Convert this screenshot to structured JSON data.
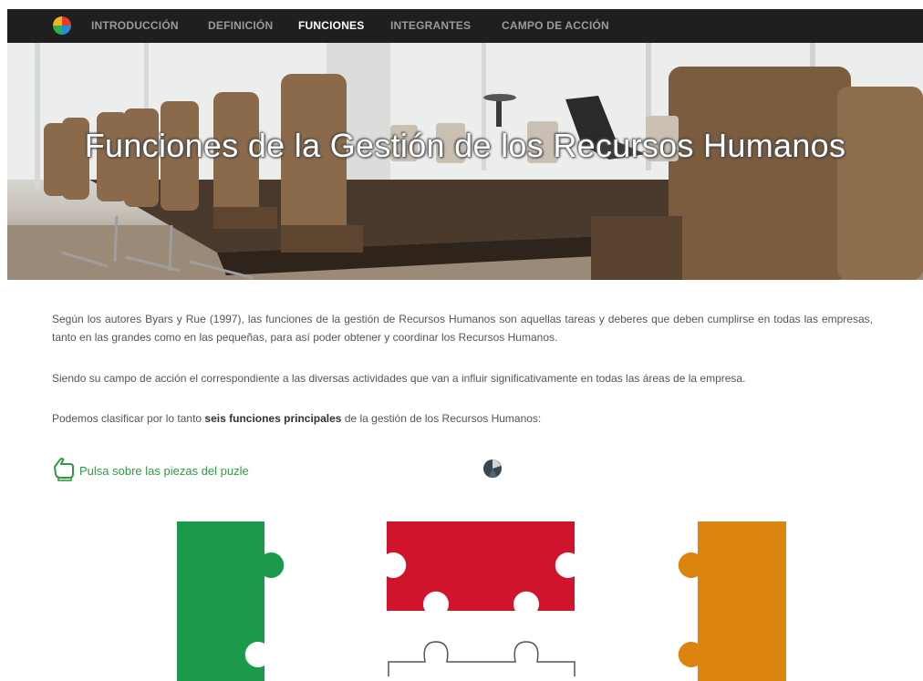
{
  "nav": {
    "items": [
      {
        "label": "INTRODUCCIÓN"
      },
      {
        "label": "DEFINICIÓN"
      },
      {
        "label": "FUNCIONES"
      },
      {
        "label": "INTEGRANTES"
      },
      {
        "label": "CAMPO DE ACCIÓN"
      }
    ],
    "active_index": 2
  },
  "hero": {
    "title": "Funciones de la Gestión de los Recursos Humanos"
  },
  "content": {
    "p1": "Según los autores Byars y Rue (1997), las funciones de la gestión de Recursos Humanos son aquellas tareas y deberes que deben cumplirse en todas las empresas, tanto en las grandes como en las pequeñas, para así poder obtener y coordinar los Recursos Humanos.",
    "p2": "Siendo su campo de acción el correspondiente a las diversas actividades que van a influir significativamente en todas las áreas de la empresa.",
    "p3_before": "Podemos clasificar por lo tanto ",
    "p3_bold": "seis funciones principales",
    "p3_after": " de la gestión de los Recursos Humanos:"
  },
  "hint": {
    "text": "Pulsa sobre las piezas del puzle",
    "icon": "pointing-hand-icon"
  },
  "loader": {
    "icon": "loading-spinner-icon"
  },
  "puzzle": {
    "colors": {
      "green": "#1a9a4a",
      "red": "#d0142c",
      "orange": "#dc8410",
      "outline": "#555555"
    }
  },
  "colors": {
    "nav_bg": "#1f1f1f",
    "nav_active": "#ffffff",
    "nav_inactive": "#9a9a9a",
    "hint": "#2f9a47"
  }
}
